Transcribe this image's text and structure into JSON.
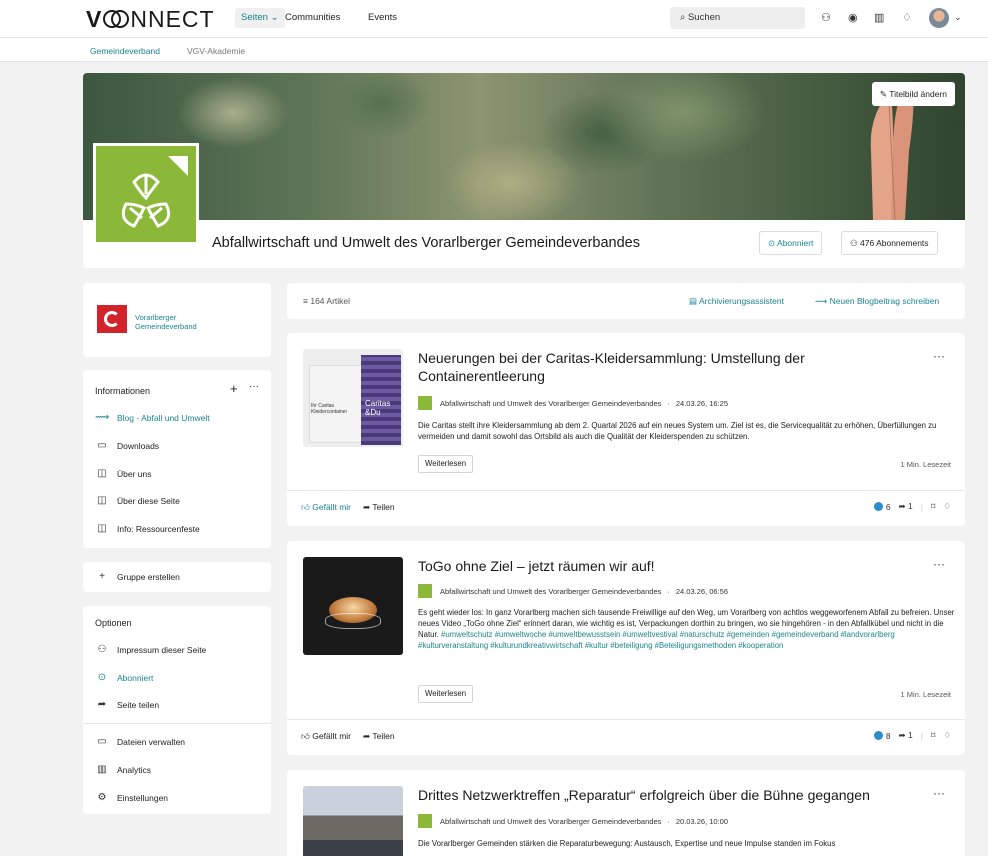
{
  "header": {
    "logo": "VCONNECT",
    "nav": [
      "Seiten",
      "Communities",
      "Events"
    ],
    "search_placeholder": "Suchen"
  },
  "subnav": [
    "Gemeindeverband",
    "VGV-Akademie"
  ],
  "hero": {
    "change_cover": "Titelbild ändern",
    "group_title": "Abfallwirtschaft und Umwelt des Vorarlberger Gemeindeverbandes",
    "subscribed": "Abonniert",
    "subscriptions": "476 Abonnements"
  },
  "sidebar": {
    "org_name_1": "Vorarlberger",
    "org_name_2": "Gemeindeverband",
    "info_title": "Informationen",
    "info_items": [
      "Blog - Abfall und Umwelt",
      "Downloads",
      "Über uns",
      "Über diese Seite",
      "Info: Ressourcenfeste"
    ],
    "create_group": "Gruppe erstellen",
    "options_title": "Optionen",
    "options_items": [
      "Impressum dieser Seite",
      "Abonniert",
      "Seite teilen"
    ],
    "admin_items": [
      "Dateien verwalten",
      "Analytics",
      "Einstellungen"
    ]
  },
  "feed": {
    "count": "164 Artikel",
    "archive": "Archivierungsassistent",
    "new_post": "Neuen Blogbeitrag schreiben",
    "posts": [
      {
        "title": "Neuerungen bei der Caritas-Kleidersammlung: Umstellung der Containerentleerung",
        "author": "Abfallwirtschaft und Umwelt des Vorarlberger Gemeindeverbandes",
        "date": "24.03.26, 16:25",
        "body": "Die Caritas stellt ihre Kleidersammlung ab dem 2. Quartal 2026 auf ein neues System um. Ziel ist es, die Servicequalität zu erhöhen, Überfüllungen zu vermeiden und damit sowohl das Ortsbild als auch die Qualität der Kleiderspenden zu schützen.",
        "tags": "",
        "readmore": "Weiterlesen",
        "readtime": "1 Min. Lesezeit",
        "like": "Gefällt mir",
        "share": "Teilen",
        "views": "6",
        "shares": "1"
      },
      {
        "title": "ToGo ohne Ziel – jetzt räumen wir auf!",
        "author": "Abfallwirtschaft und Umwelt des Vorarlberger Gemeindeverbandes",
        "date": "24.03.26, 06:56",
        "body": "Es geht wieder los: In ganz Vorarlberg machen sich tausende Freiwillige auf den Weg, um Vorarlberg von achtlos weggeworfenem Abfall zu befreien. Unser neues Video „ToGo ohne Ziel“ erinnert daran, wie wichtig es ist, Verpackungen dorthin zu bringen, wo sie hingehören - in den Abfallkübel und nicht in die Natur.",
        "tags": "#umweltschutz #umweltwoche #umweltbewusstsein #umweltvestival #naturschutz #gemeinden #gemeindeverband #landvorarlberg #kulturveranstaltung #kulturundkreativwirtschaft #kultur #beteiligung #Beteiligungsmethoden #kooperation",
        "readmore": "Weiterlesen",
        "readtime": "1 Min. Lesezeit",
        "like": "Gefällt mir",
        "share": "Teilen",
        "views": "8",
        "shares": "1"
      },
      {
        "title": "Drittes Netzwerktreffen „Reparatur“ erfolgreich über die Bühne gegangen",
        "author": "Abfallwirtschaft und Umwelt des Vorarlberger Gemeindeverbandes",
        "date": "20.03.26, 10:00",
        "body": "Die Vorarlberger Gemeinden stärken die Reparaturbewegung: Austausch, Expertise und neue Impulse standen im Fokus"
      }
    ]
  },
  "colors": {
    "accent": "#1a8591",
    "brand_green": "#8cb83a",
    "brand_red": "#d2232a",
    "view_dot": "#2b8cce"
  },
  "icons": [
    "search-icon",
    "people-icon",
    "compass-icon",
    "analytics-icon",
    "bell-icon",
    "pencil-icon",
    "check-circle-icon",
    "filter-icon",
    "archive-icon",
    "megaphone-icon",
    "plus-icon",
    "more-icon",
    "folder-icon",
    "layout-icon",
    "like-icon",
    "share-icon",
    "bookmark-icon"
  ]
}
